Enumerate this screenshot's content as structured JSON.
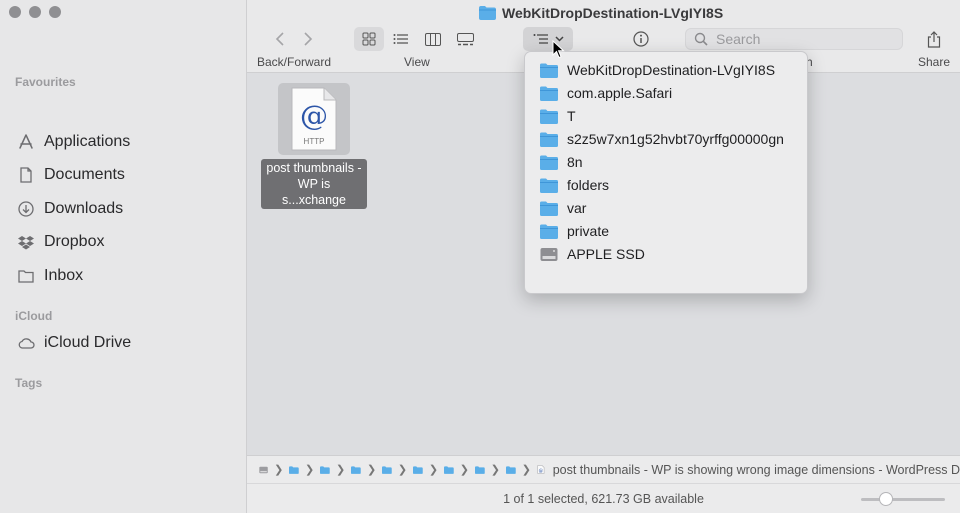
{
  "window": {
    "title": "WebKitDropDestination-LVgIYI8S"
  },
  "sidebar": {
    "favourites_label": "Favourites",
    "items": [
      {
        "label": "Applications",
        "icon": "applications-icon"
      },
      {
        "label": "Documents",
        "icon": "document-icon"
      },
      {
        "label": "Downloads",
        "icon": "download-icon"
      },
      {
        "label": "Dropbox",
        "icon": "dropbox-icon"
      },
      {
        "label": "Inbox",
        "icon": "folder-icon"
      }
    ],
    "icloud_label": "iCloud",
    "icloud_items": [
      {
        "label": "iCloud Drive",
        "icon": "cloud-icon"
      }
    ],
    "tags_label": "Tags"
  },
  "toolbar": {
    "back_forward_label": "Back/Forward",
    "view_label": "View",
    "group_label": "h",
    "share_label": "Share",
    "search_placeholder": "Search"
  },
  "files": [
    {
      "name": "post thumbnails - WP is s...xchange",
      "type_badge": "HTTP",
      "selected": true
    }
  ],
  "path_menu": {
    "items": [
      {
        "label": "WebKitDropDestination-LVgIYI8S",
        "icon": "folder-icon"
      },
      {
        "label": "com.apple.Safari",
        "icon": "folder-icon"
      },
      {
        "label": "T",
        "icon": "folder-icon"
      },
      {
        "label": "s2z5w7xn1g52hvbt70yrffg00000gn",
        "icon": "folder-icon"
      },
      {
        "label": "8n",
        "icon": "folder-icon"
      },
      {
        "label": "folders",
        "icon": "folder-icon"
      },
      {
        "label": "var",
        "icon": "folder-icon"
      },
      {
        "label": "private",
        "icon": "folder-icon"
      },
      {
        "label": "APPLE SSD",
        "icon": "disk-icon"
      }
    ]
  },
  "pathbar": {
    "file_label": "post thumbnails - WP is showing wrong image dimensions - WordPress D"
  },
  "status": {
    "text": "1 of 1 selected, 621.73 GB available",
    "icon_size_level": 0.25
  },
  "colors": {
    "folder": "#5aaee8",
    "sidebar_bg": "#e7e7e8",
    "content_bg": "#dcdde0",
    "selection": "#6f6f72"
  }
}
